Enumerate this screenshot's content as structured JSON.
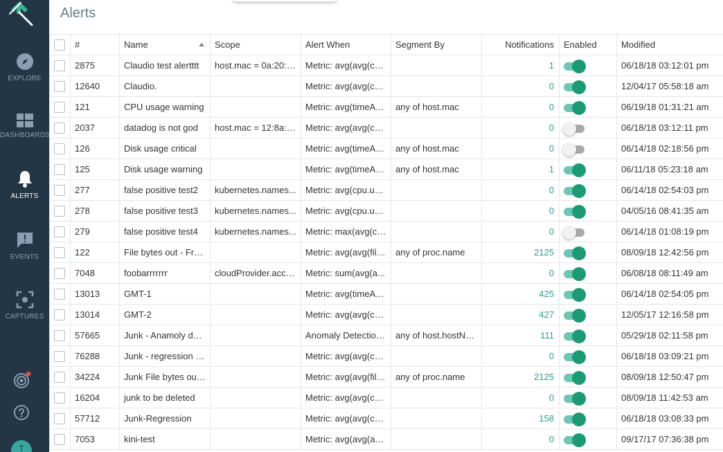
{
  "page": {
    "title": "Alerts"
  },
  "sidebar": {
    "items": [
      {
        "label": "EXPLORE",
        "icon": "compass-icon"
      },
      {
        "label": "DASHBOARDS",
        "icon": "dashboard-icon"
      },
      {
        "label": "ALERTS",
        "icon": "bell-icon"
      },
      {
        "label": "EVENTS",
        "icon": "speech-bubble-icon"
      },
      {
        "label": "CAPTURES",
        "icon": "capture-icon"
      }
    ],
    "bottom": [
      {
        "icon": "radar-icon"
      },
      {
        "icon": "help-icon"
      }
    ],
    "avatar_initial": "T",
    "accent": "#1c9a76"
  },
  "table": {
    "headers": {
      "number": "#",
      "name": "Name",
      "scope": "Scope",
      "alert_when": "Alert When",
      "segment_by": "Segment By",
      "notifications": "Notifications",
      "enabled": "Enabled",
      "modified": "Modified"
    },
    "rows": [
      {
        "id": "2875",
        "name": "Claudio test alertttt",
        "scope": "host.mac = 0a:20:d...",
        "alert_when": "Metric: avg(avg(cp...",
        "segment_by": "",
        "notifications": "1",
        "enabled": true,
        "modified": "06/18/18 03:12:01 pm"
      },
      {
        "id": "12640",
        "name": "Claudio.",
        "scope": "",
        "alert_when": "Metric: avg(avg(cp...",
        "segment_by": "",
        "notifications": "0",
        "enabled": true,
        "modified": "12/04/17 05:58:18 am"
      },
      {
        "id": "121",
        "name": "CPU usage warning",
        "scope": "",
        "alert_when": "Metric: avg(timeAv...",
        "segment_by": "any of host.mac",
        "notifications": "0",
        "enabled": true,
        "modified": "06/19/18 01:31:21 am"
      },
      {
        "id": "2037",
        "name": "datadog is not god",
        "scope": "host.mac = 12:8a:a...",
        "alert_when": "Metric: avg(avg(cp...",
        "segment_by": "",
        "notifications": "0",
        "enabled": false,
        "modified": "06/18/18 03:12:11 pm"
      },
      {
        "id": "126",
        "name": "Disk usage critical",
        "scope": "",
        "alert_when": "Metric: avg(timeAv...",
        "segment_by": "any of host.mac",
        "notifications": "0",
        "enabled": false,
        "modified": "06/14/18 02:18:56 pm"
      },
      {
        "id": "125",
        "name": "Disk usage warning",
        "scope": "",
        "alert_when": "Metric: avg(timeAv...",
        "segment_by": "any of host.mac",
        "notifications": "1",
        "enabled": true,
        "modified": "06/11/18 05:23:18 am"
      },
      {
        "id": "277",
        "name": "false positive test2",
        "scope": "kubernetes.names...",
        "alert_when": "Metric: avg(cpu.us...",
        "segment_by": "",
        "notifications": "0",
        "enabled": true,
        "modified": "06/14/18 02:54:03 pm"
      },
      {
        "id": "278",
        "name": "false positive test3",
        "scope": "kubernetes.names...",
        "alert_when": "Metric: avg(cpu.us...",
        "segment_by": "",
        "notifications": "0",
        "enabled": true,
        "modified": "04/05/16 08:41:35 am"
      },
      {
        "id": "279",
        "name": "false positive test4",
        "scope": "kubernetes.names...",
        "alert_when": "Metric: max(avg(cp...",
        "segment_by": "",
        "notifications": "0",
        "enabled": false,
        "modified": "06/14/18 01:08:19 pm"
      },
      {
        "id": "122",
        "name": "File bytes out - Fro...",
        "scope": "",
        "alert_when": "Metric: avg(avg(file...",
        "segment_by": "any of proc.name",
        "notifications": "2125",
        "enabled": true,
        "modified": "08/09/18 12:42:56 pm"
      },
      {
        "id": "7048",
        "name": "foobarrrrrrr",
        "scope": "cloudProvider.acco...",
        "alert_when": "Metric: sum(avg(a...",
        "segment_by": "",
        "notifications": "0",
        "enabled": true,
        "modified": "06/08/18 08:11:49 am"
      },
      {
        "id": "13013",
        "name": "GMT-1",
        "scope": "",
        "alert_when": "Metric: avg(timeAv...",
        "segment_by": "",
        "notifications": "425",
        "enabled": true,
        "modified": "06/14/18 02:54:05 pm"
      },
      {
        "id": "13014",
        "name": "GMT-2",
        "scope": "",
        "alert_when": "Metric: avg(avg(cp...",
        "segment_by": "",
        "notifications": "427",
        "enabled": true,
        "modified": "12/05/17 12:16:58 pm"
      },
      {
        "id": "57665",
        "name": "Junk - Anamoly det...",
        "scope": "",
        "alert_when": "Anomaly Detection:...",
        "segment_by": "any of host.hostNa...",
        "notifications": "111",
        "enabled": true,
        "modified": "05/29/18 02:11:58 pm"
      },
      {
        "id": "76288",
        "name": "Junk - regression N...",
        "scope": "",
        "alert_when": "Metric: avg(avg(cp...",
        "segment_by": "",
        "notifications": "0",
        "enabled": true,
        "modified": "06/18/18 03:09:21 pm"
      },
      {
        "id": "34224",
        "name": "Junk File bytes out ...",
        "scope": "",
        "alert_when": "Metric: avg(avg(file...",
        "segment_by": "any of proc.name",
        "notifications": "2125",
        "enabled": true,
        "modified": "08/09/18 12:50:47 pm"
      },
      {
        "id": "16204",
        "name": "junk to be deleted",
        "scope": "",
        "alert_when": "Metric: avg(avg(cp...",
        "segment_by": "",
        "notifications": "0",
        "enabled": true,
        "modified": "08/09/18 11:42:53 am"
      },
      {
        "id": "57712",
        "name": "Junk-Regression",
        "scope": "",
        "alert_when": "Metric: avg(avg(cp...",
        "segment_by": "",
        "notifications": "158",
        "enabled": true,
        "modified": "06/18/18 03:08:33 pm"
      },
      {
        "id": "7053",
        "name": "kini-test",
        "scope": "",
        "alert_when": "Metric: avg(avg(an...",
        "segment_by": "",
        "notifications": "0",
        "enabled": true,
        "modified": "09/17/17 07:36:38 pm"
      }
    ]
  }
}
